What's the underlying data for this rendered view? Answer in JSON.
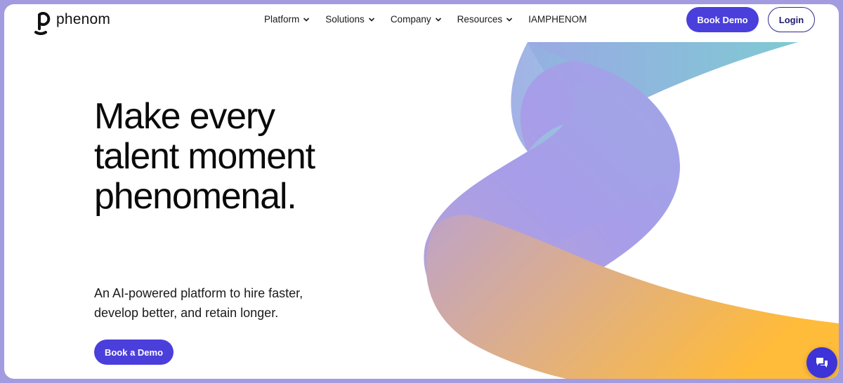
{
  "brand": {
    "name": "phenom",
    "accent": "#4a3fdb",
    "frame_color": "#a39be0"
  },
  "nav": {
    "items": [
      {
        "label": "Platform",
        "has_dropdown": true
      },
      {
        "label": "Solutions",
        "has_dropdown": true
      },
      {
        "label": "Company",
        "has_dropdown": true
      },
      {
        "label": "Resources",
        "has_dropdown": true
      },
      {
        "label": "IAMPHENOM",
        "has_dropdown": false
      }
    ],
    "book_demo_label": "Book Demo",
    "login_label": "Login"
  },
  "hero": {
    "headline_lines": [
      "Make every",
      "talent moment",
      "phenomenal."
    ],
    "subtitle_lines": [
      "An AI-powered platform to hire faster,",
      "develop better, and retain longer."
    ],
    "cta_label": "Book a Demo"
  },
  "icons": {
    "chat": "chat-bubbles-icon",
    "chevron": "chevron-down-icon",
    "logo": "phenom-logo-icon"
  }
}
